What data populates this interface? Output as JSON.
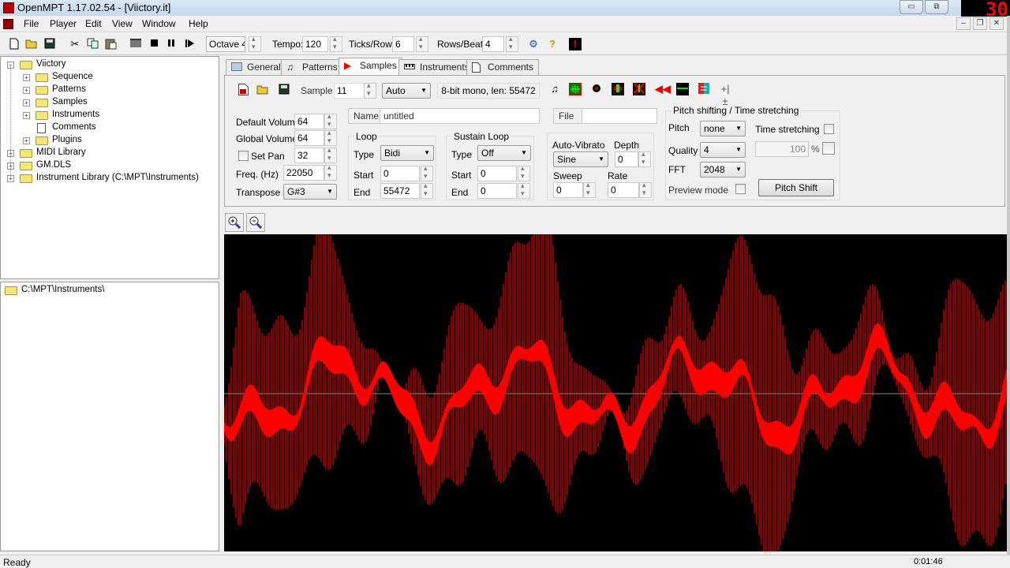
{
  "window": {
    "title": "OpenMPT 1.17.02.54 - [Viictory.it]",
    "overlay_counter": "30",
    "buttons": {
      "minimize": "▭",
      "restore": "⧉"
    }
  },
  "menu": [
    "File",
    "Player",
    "Edit",
    "View",
    "Window",
    "Help"
  ],
  "mdi_buttons": {
    "minimize": "–",
    "restore": "❐",
    "close": "✕"
  },
  "toolbar": {
    "icons": [
      "new-file",
      "open-folder",
      "save",
      "cut",
      "copy",
      "paste",
      "play-pattern",
      "stop",
      "pause",
      "play"
    ],
    "octave": "Octave 4",
    "tempo_label": "Tempo:",
    "tempo_value": "120",
    "ticks_label": "Ticks/Row:",
    "ticks_value": "6",
    "rows_beat_label": "Rows/Beat:",
    "rows_beat_value": "4"
  },
  "tree": {
    "items": [
      {
        "label": "Viictory",
        "level": 0,
        "expander": "−",
        "type": "folder"
      },
      {
        "label": "Sequence",
        "level": 1,
        "expander": "+",
        "type": "folder"
      },
      {
        "label": "Patterns",
        "level": 1,
        "expander": "+",
        "type": "folder"
      },
      {
        "label": "Samples",
        "level": 1,
        "expander": "+",
        "type": "folder"
      },
      {
        "label": "Instruments",
        "level": 1,
        "expander": "+",
        "type": "folder"
      },
      {
        "label": "Comments",
        "level": 1,
        "expander": "",
        "type": "doc"
      },
      {
        "label": "Plugins",
        "level": 1,
        "expander": "+",
        "type": "folder"
      },
      {
        "label": "MIDI Library",
        "level": 0,
        "expander": "+",
        "type": "folder"
      },
      {
        "label": "GM.DLS",
        "level": 0,
        "expander": "+",
        "type": "folder"
      },
      {
        "label": "Instrument Library (C:\\MPT\\Instruments)",
        "level": 0,
        "expander": "+",
        "type": "folder"
      }
    ]
  },
  "library": {
    "path": "C:\\MPT\\Instruments\\"
  },
  "tabs": [
    {
      "label": "General",
      "active": false
    },
    {
      "label": "Patterns",
      "active": false
    },
    {
      "label": "Samples",
      "active": true
    },
    {
      "label": "Instruments",
      "active": false
    },
    {
      "label": "Comments",
      "active": false
    }
  ],
  "sample": {
    "label": "Sample",
    "number": "11",
    "mode": "Auto",
    "info": "8-bit mono, len: 55472",
    "name_label": "Name",
    "name": "untitled",
    "file_label": "File",
    "file": "",
    "default_volume_label": "Default Volume",
    "default_volume": "64",
    "global_volume_label": "Global Volume",
    "global_volume": "64",
    "set_pan_label": "Set Pan",
    "set_pan_checked": false,
    "pan": "32",
    "freq_label": "Freq. (Hz)",
    "freq": "22050",
    "transpose_label": "Transpose",
    "transpose": "G#3",
    "loop": {
      "title": "Loop",
      "type_label": "Type",
      "type": "Bidi",
      "start_label": "Start",
      "start": "0",
      "end_label": "End",
      "end": "55472"
    },
    "sustain": {
      "title": "Sustain Loop",
      "type_label": "Type",
      "type": "Off",
      "start_label": "Start",
      "start": "0",
      "end_label": "End",
      "end": "0"
    },
    "vibrato": {
      "title": "Auto-Vibrato",
      "type": "Sine",
      "depth_label": "Depth",
      "depth": "0",
      "sweep_label": "Sweep",
      "sweep": "0",
      "rate_label": "Rate",
      "rate": "0"
    },
    "pitch": {
      "title": "Pitch shifting / Time stretching",
      "pitch_label": "Pitch",
      "pitch": "none",
      "time_stretch_label": "Time stretching",
      "quality_label": "Quality",
      "quality": "4",
      "percent": "100",
      "percent_sign": "%",
      "fft_label": "FFT",
      "fft": "2048",
      "preview_label": "Preview mode",
      "pitch_shift_button": "Pitch Shift"
    },
    "tool_icons": [
      "note",
      "normalize",
      "dot",
      "amplify",
      "silence",
      "reverse",
      "center",
      "sign",
      "plus-minus"
    ]
  },
  "status": {
    "text": "Ready",
    "time": "0:01:46"
  },
  "colors": {
    "wave_dark": "#8a0000",
    "wave_bright": "#ff0000",
    "wave_bg": "#000000",
    "centerline": "#888888"
  }
}
